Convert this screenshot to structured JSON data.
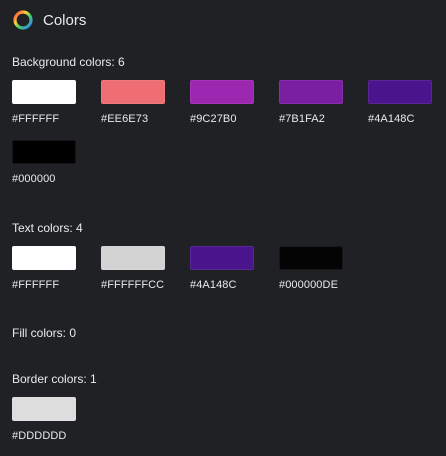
{
  "header": {
    "title": "Colors",
    "icon": "color-ring-icon"
  },
  "sections": {
    "background": {
      "title": "Background colors: 6",
      "swatches": [
        {
          "color": "#FFFFFF",
          "label": "#FFFFFF"
        },
        {
          "color": "#EE6E73",
          "label": "#EE6E73"
        },
        {
          "color": "#9C27B0",
          "label": "#9C27B0"
        },
        {
          "color": "#7B1FA2",
          "label": "#7B1FA2"
        },
        {
          "color": "#4A148C",
          "label": "#4A148C"
        },
        {
          "color": "#000000",
          "label": "#000000"
        }
      ]
    },
    "text": {
      "title": "Text colors: 4",
      "swatches": [
        {
          "color": "#FFFFFF",
          "label": "#FFFFFF"
        },
        {
          "color": "#FFFFFFCC",
          "label": "#FFFFFFCC"
        },
        {
          "color": "#4A148C",
          "label": "#4A148C"
        },
        {
          "color": "#000000DE",
          "label": "#000000DE"
        }
      ]
    },
    "fill": {
      "title": "Fill colors: 0",
      "swatches": []
    },
    "border": {
      "title": "Border colors: 1",
      "swatches": [
        {
          "color": "#DDDDDD",
          "label": "#DDDDDD"
        }
      ]
    }
  }
}
